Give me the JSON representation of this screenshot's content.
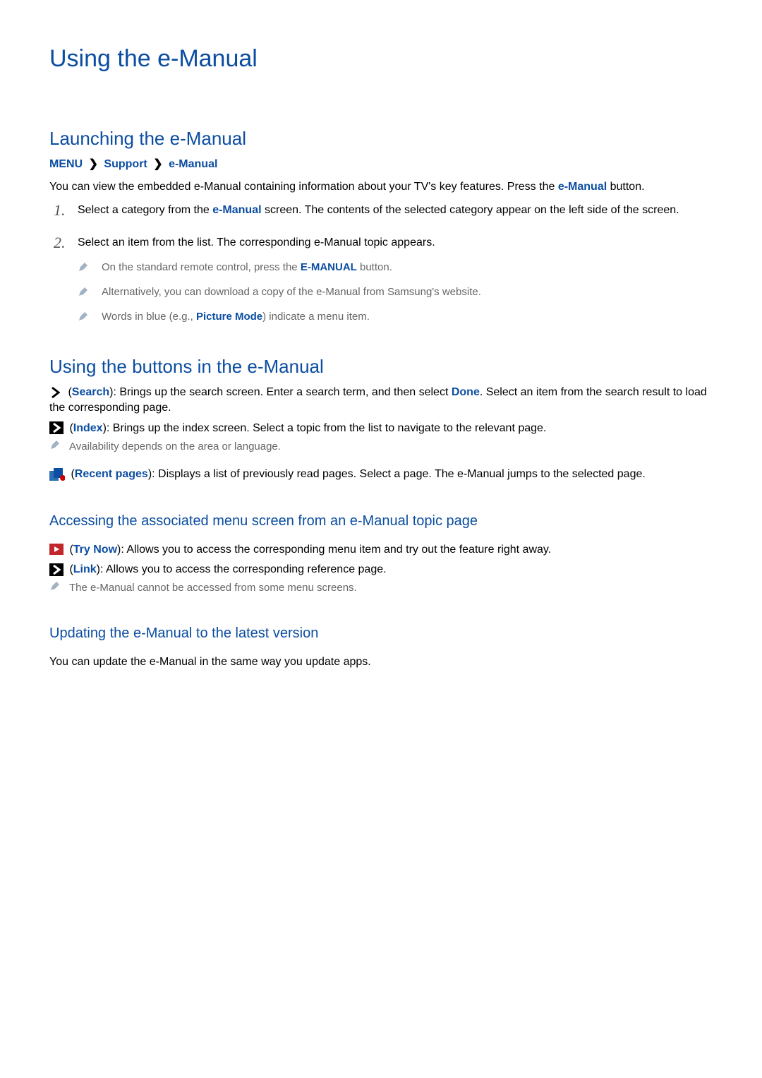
{
  "page_title": "Using the e-Manual",
  "section1": {
    "title": "Launching the e-Manual",
    "breadcrumb": {
      "menu": "MENU",
      "support": "Support",
      "emanual": "e-Manual"
    },
    "intro_pre": "You can view the embedded e-Manual containing information about your TV's key features. Press the ",
    "intro_kw": "e-Manual",
    "intro_post": " button.",
    "steps": [
      {
        "num": "1.",
        "pre": "Select a category from the ",
        "kw": "e-Manual",
        "post": " screen. The contents of the selected category appear on the left side of the screen."
      },
      {
        "num": "2.",
        "pre": "Select an item from the list. The corresponding e-Manual topic appears.",
        "kw": "",
        "post": ""
      }
    ],
    "notes": [
      {
        "pre": "On the standard remote control, press the ",
        "kw": "E-MANUAL",
        "post": " button."
      },
      {
        "pre": "Alternatively, you can download a copy of the e-Manual from Samsung's website.",
        "kw": "",
        "post": ""
      },
      {
        "pre": "Words in blue (e.g., ",
        "kw": "Picture Mode",
        "post": ") indicate a menu item."
      }
    ]
  },
  "section2": {
    "title": "Using the buttons in the e-Manual",
    "features": [
      {
        "icon": "chevron",
        "label": "Search",
        "desc_pre": "): Brings up the search screen. Enter a search term, and then select ",
        "done": "Done",
        "desc_post": ". Select an item from the search result to load the corresponding page."
      },
      {
        "icon": "box-chevron",
        "label": "Index",
        "desc_pre": "): Brings up the index screen. Select a topic from the list to navigate to the relevant page.",
        "done": "",
        "desc_post": ""
      }
    ],
    "index_note": "Availability depends on the area or language.",
    "recent": {
      "label": "Recent pages",
      "desc": "): Displays a list of previously read pages. Select a page. The e-Manual jumps to the selected page."
    },
    "sub_access": {
      "title": "Accessing the associated menu screen from an e-Manual topic page",
      "items": [
        {
          "icon": "play-box",
          "label": "Try Now",
          "desc": "): Allows you to access the corresponding menu item and try out the feature right away."
        },
        {
          "icon": "box-chevron",
          "label": "Link",
          "desc": "): Allows you to access the corresponding reference page."
        }
      ],
      "note": "The e-Manual cannot be accessed from some menu screens."
    },
    "sub_update": {
      "title": "Updating the e-Manual to the latest version",
      "text": "You can update the e-Manual in the same way you update apps."
    }
  }
}
